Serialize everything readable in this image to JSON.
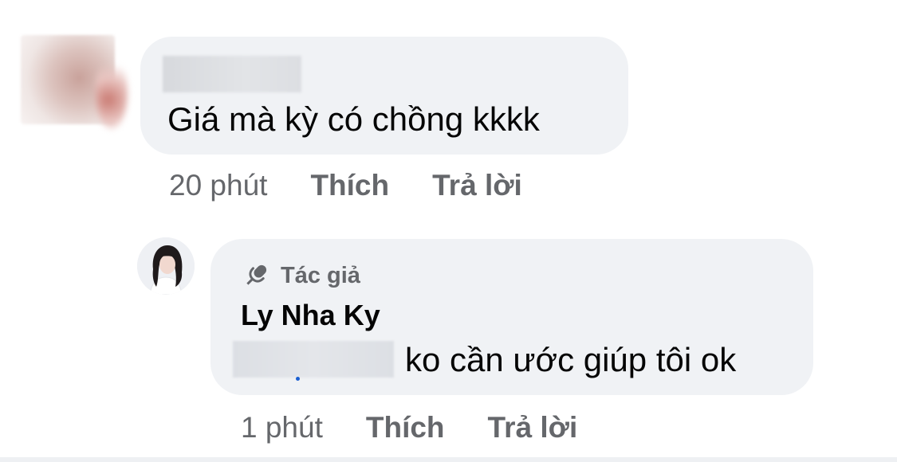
{
  "comment": {
    "text": "Giá mà kỳ có chồng kkkk",
    "time": "20 phút",
    "like_label": "Thích",
    "reply_label": "Trả lời"
  },
  "reply": {
    "badge_label": "Tác giả",
    "badge_icon": "microphone-icon",
    "author_name": "Ly Nha Ky",
    "text": "ko cần ước giúp tôi ok",
    "time": "1 phút",
    "like_label": "Thích",
    "reply_label": "Trả lời"
  },
  "colors": {
    "bubble": "#f0f2f5",
    "meta_text": "#65676b",
    "primary_text": "#050505",
    "mention_dot": "#1b5fd1"
  }
}
